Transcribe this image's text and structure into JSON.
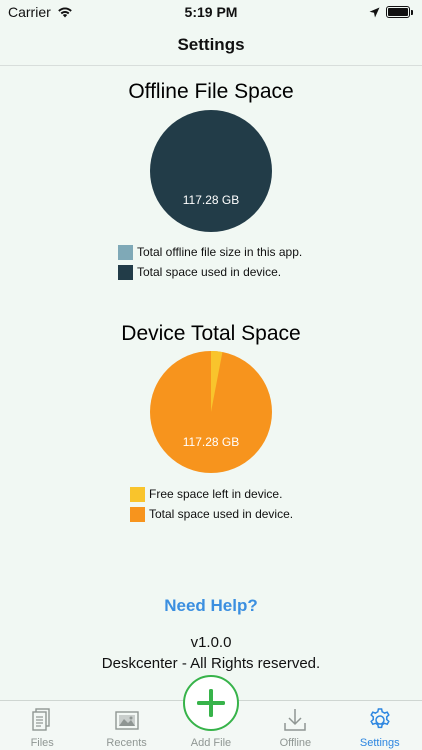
{
  "status_bar": {
    "carrier": "Carrier",
    "time": "5:19 PM"
  },
  "nav": {
    "title": "Settings"
  },
  "offline_section": {
    "title": "Offline File Space",
    "pie_label": "117.28 GB",
    "legend": [
      {
        "label": "Total offline file size in this app.",
        "color": "#7fa9b7"
      },
      {
        "label": "Total space used in device.",
        "color": "#223c48"
      }
    ]
  },
  "device_section": {
    "title": "Device Total Space",
    "pie_label": "117.28 GB",
    "free_fraction": 0.03,
    "legend": [
      {
        "label": "Free space left in device.",
        "color": "#f9c42c"
      },
      {
        "label": "Total space used in device.",
        "color": "#f7941d"
      }
    ]
  },
  "help": {
    "link": "Need Help?",
    "version": "v1.0.0",
    "copyright": "Deskcenter - All Rights reserved."
  },
  "tabs": [
    {
      "label": "Files",
      "icon": "files-icon"
    },
    {
      "label": "Recents",
      "icon": "recents-icon"
    },
    {
      "label": "Add File",
      "icon": "plus-icon"
    },
    {
      "label": "Offline",
      "icon": "download-icon"
    },
    {
      "label": "Settings",
      "icon": "gear-icon"
    }
  ],
  "colors": {
    "accent": "#2d86e0",
    "add_button": "#37b34a",
    "background": "#f1f8f3"
  }
}
